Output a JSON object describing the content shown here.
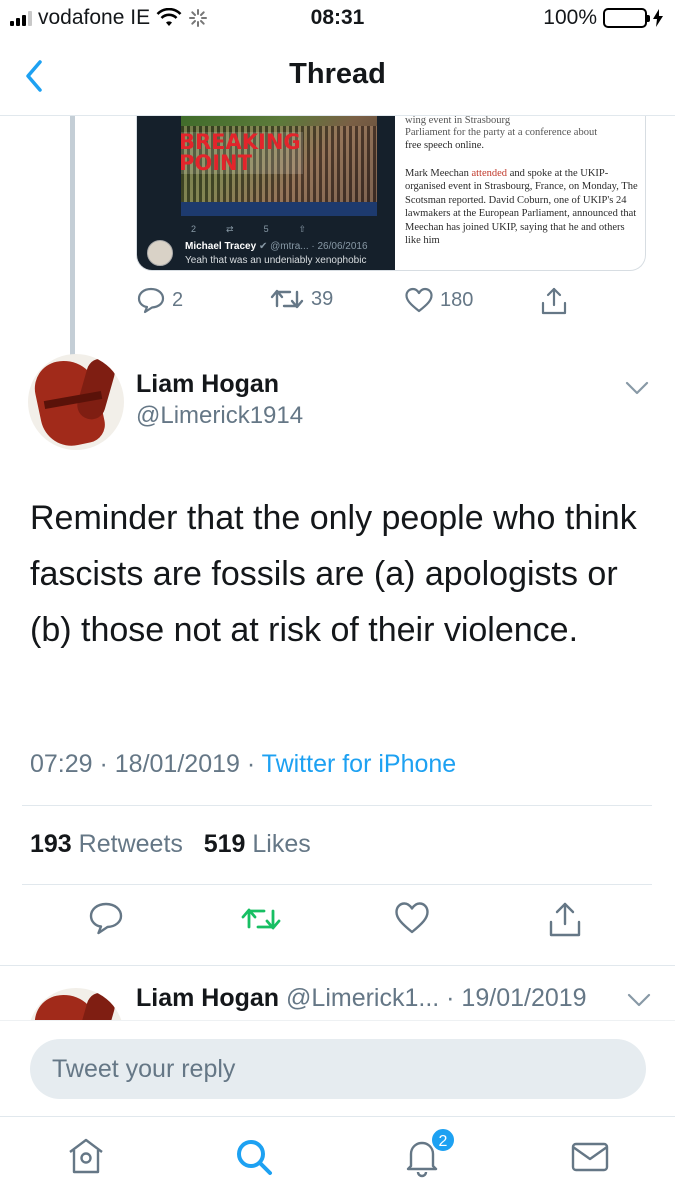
{
  "status_bar": {
    "carrier": "vodafone IE",
    "time": "08:31",
    "battery": "100%",
    "battery_level": 1.0
  },
  "nav": {
    "title": "Thread",
    "back_icon": "chevron-left-icon"
  },
  "previous_tweet": {
    "quoted_image": {
      "poster_text": [
        "BREAKING",
        "POINT"
      ],
      "embedded_author": "Michael Tracey",
      "embedded_handle": "@mtra...",
      "embedded_date": "26/06/2016",
      "embedded_text": "Yeah that was an undeniably xenophobic",
      "embedded_counts": [
        "2",
        "5"
      ]
    },
    "article_snippet": {
      "cut_line_1": "wing event in Strasbourg",
      "cut_line_2": "Parliament for the party at a conference about",
      "line_3": "free speech online.",
      "para2_before": "Mark Meechan ",
      "para2_red": "attended",
      "para2_after": " and spoke at the UKIP-organised event in Strasbourg, France, on Monday, The Scotsman reported. David Coburn, one of UKIP's 24 lawmakers at the European Parliament, announced that Meechan has joined UKIP, saying that he and others like him"
    },
    "actions": {
      "replies": "2",
      "retweets": "39",
      "likes": "180"
    }
  },
  "tweet": {
    "name": "Liam Hogan",
    "handle": "@Limerick1914",
    "text": "Reminder that the only people who think fascists are fossils are (a) apologists or (b) those not at risk of their violence.",
    "time": "07:29 · 18/01/2019 · ",
    "source": "Twitter for iPhone",
    "retweet_count": "193",
    "retweet_label": "Retweets",
    "like_count": "519",
    "like_label": "Likes",
    "retweeted": true,
    "accent_color": "#1da1f2",
    "retweet_color": "#17bf63"
  },
  "next_reply": {
    "name": "Liam Hogan",
    "handle_date": "@Limerick1... · 19/01/2019"
  },
  "reply": {
    "placeholder": "Tweet your reply"
  },
  "tabbar": {
    "tabs": [
      {
        "icon": "home-icon"
      },
      {
        "icon": "search-icon",
        "active": true
      },
      {
        "icon": "notifications-icon",
        "badge": "2"
      },
      {
        "icon": "messages-icon"
      }
    ]
  }
}
